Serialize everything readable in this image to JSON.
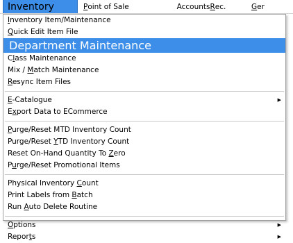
{
  "menubar": {
    "items": [
      {
        "pre": "Inventory",
        "ul": "",
        "post": ""
      },
      {
        "pre": "",
        "ul": "P",
        "post": "oint of Sale"
      },
      {
        "pre": "Accounts ",
        "ul": "R",
        "post": "ec."
      },
      {
        "pre": "",
        "ul": "G",
        "post": "er"
      }
    ]
  },
  "menu": {
    "items": [
      {
        "pre": "",
        "ul": "I",
        "post": "nventory Item/Maintenance"
      },
      {
        "pre": "",
        "ul": "Q",
        "post": "uick Edit Item File"
      },
      {
        "pre": "",
        "ul": "D",
        "post": "epartment Maintenance"
      },
      {
        "pre": "C",
        "ul": "l",
        "post": "ass Maintenance"
      },
      {
        "pre": "Mix / ",
        "ul": "M",
        "post": "atch Maintenance"
      },
      {
        "pre": "",
        "ul": "R",
        "post": "esync Item Files"
      },
      {
        "pre": "",
        "ul": "E",
        "post": "-Catalogue"
      },
      {
        "pre": "E",
        "ul": "x",
        "post": "port Data to ECommerce"
      },
      {
        "pre": "",
        "ul": "P",
        "post": "urge/Reset  MTD Inventory Count"
      },
      {
        "pre": "Purge/Reset  ",
        "ul": "Y",
        "post": "TD Inventory Count"
      },
      {
        "pre": "Reset On-Hand Quantity To ",
        "ul": "Z",
        "post": "ero"
      },
      {
        "pre": "P",
        "ul": "u",
        "post": "rge/Reset Promotional Items"
      },
      {
        "pre": "Physical Inventory ",
        "ul": "C",
        "post": "ount"
      },
      {
        "pre": "Print Labels from ",
        "ul": "B",
        "post": "atch"
      },
      {
        "pre": "Run ",
        "ul": "A",
        "post": "uto Delete Routine"
      },
      {
        "pre": "",
        "ul": "O",
        "post": "ptions"
      },
      {
        "pre": "Repor",
        "ul": "t",
        "post": "s"
      }
    ]
  },
  "submenu_arrow": "▶",
  "colors": {
    "highlight": "#3c8ee8"
  }
}
